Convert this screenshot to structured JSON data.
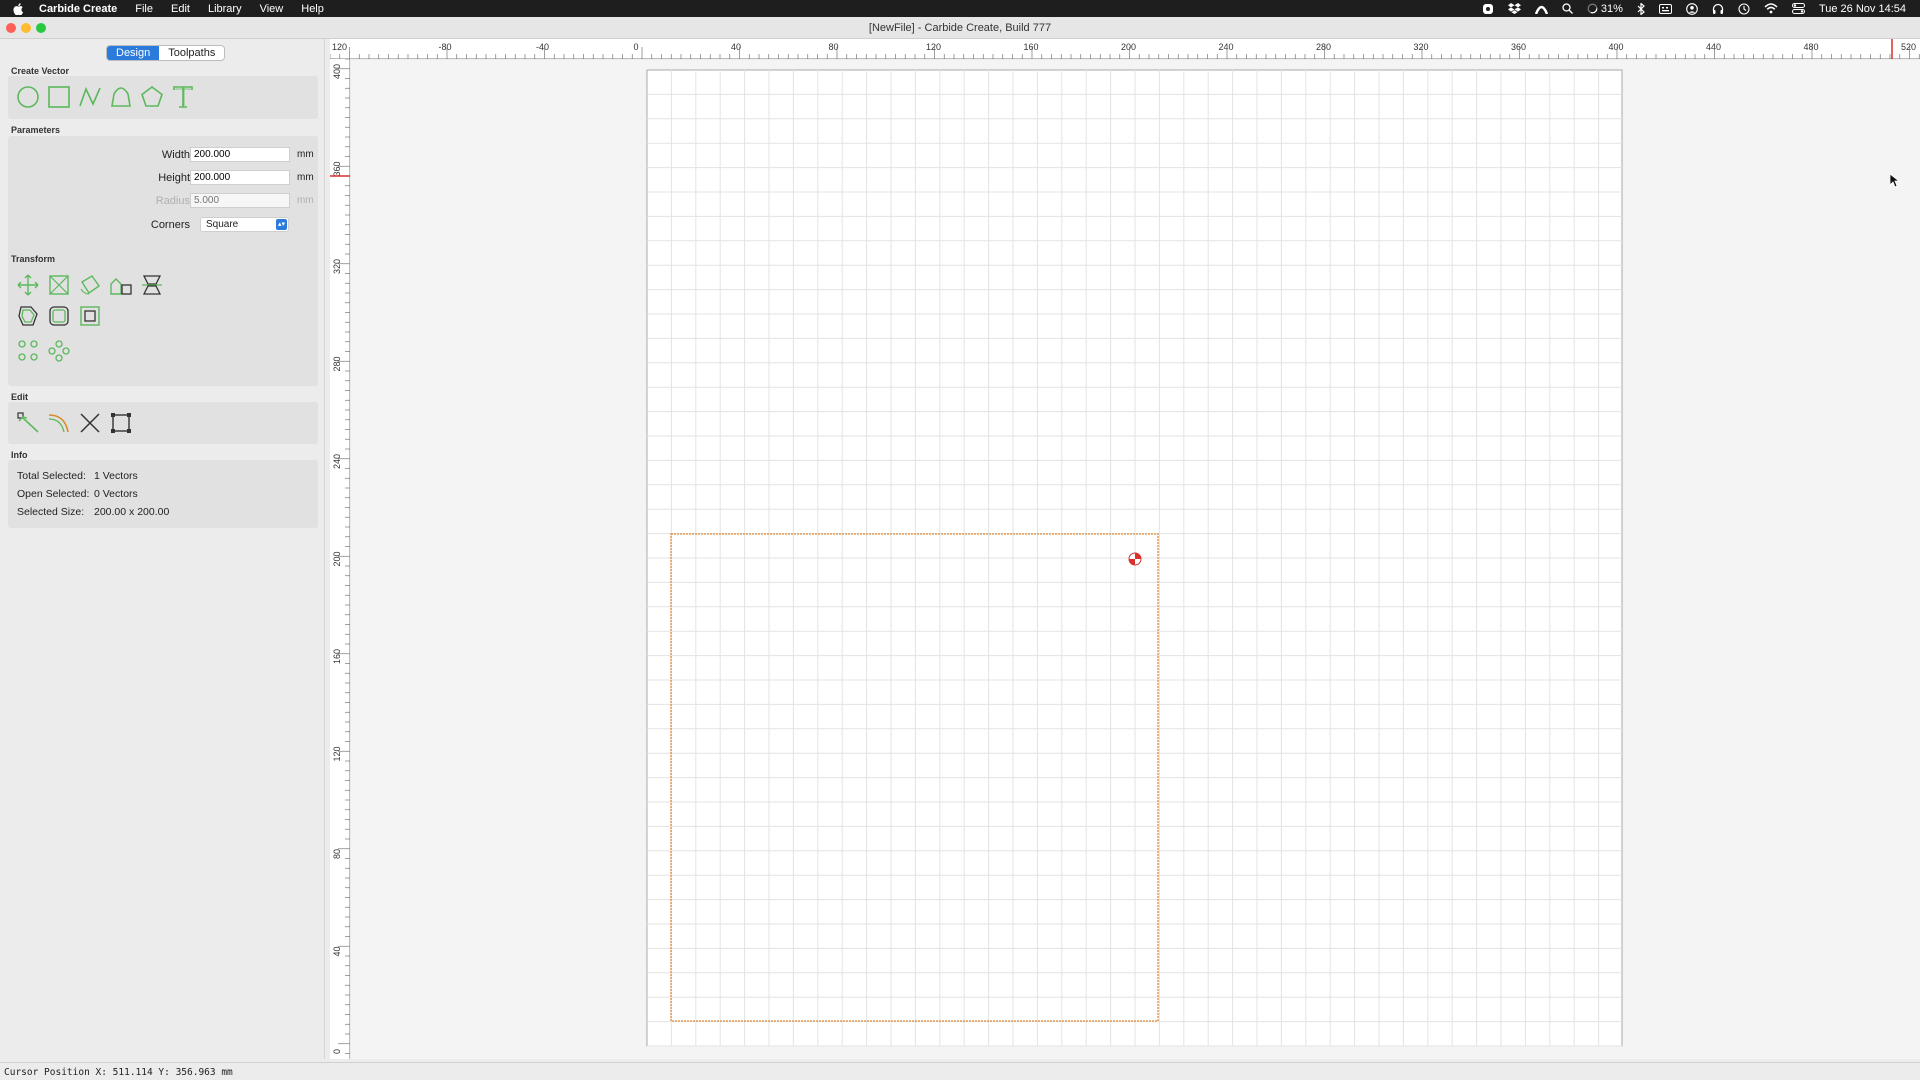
{
  "menubar": {
    "app_name": "Carbide Create",
    "items": [
      "File",
      "Edit",
      "Library",
      "View",
      "Help"
    ],
    "battery": "31%",
    "datetime": "Tue 26 Nov  14:54"
  },
  "window": {
    "title": "[NewFile] - Carbide Create, Build 777"
  },
  "tabs": [
    "Design",
    "Toolpaths"
  ],
  "sections": {
    "create_vector": "Create Vector",
    "parameters": "Parameters",
    "transform": "Transform",
    "edit": "Edit",
    "info": "Info"
  },
  "parameters": {
    "width_label": "Width",
    "width_value": "200.000",
    "height_label": "Height",
    "height_value": "200.000",
    "radius_label": "Radius",
    "radius_placeholder": "5.000",
    "unit": "mm",
    "corners_label": "Corners",
    "corners_value": "Square"
  },
  "info": {
    "total_selected_label": "Total Selected:",
    "total_selected_value": "1 Vectors",
    "open_selected_label": "Open Selected:",
    "open_selected_value": "0 Vectors",
    "selected_size_label": "Selected Size:",
    "selected_size_value": "200.00 x 200.00"
  },
  "rulers": {
    "top_labels": [
      "120",
      "-80",
      "-40",
      "0",
      "40",
      "80",
      "120",
      "160",
      "200",
      "240",
      "280",
      "320",
      "360",
      "400",
      "440",
      "480",
      "520"
    ],
    "left_labels": [
      "400",
      "360",
      "320",
      "280",
      "240",
      "200",
      "160",
      "120",
      "80",
      "40",
      "0"
    ]
  },
  "status": {
    "cursor_position": "Cursor Position X: 511.114 Y: 356.963 mm"
  },
  "colors": {
    "accent": "#2a7bdc",
    "tool_icon_green": "#5cb85c",
    "selection_orange": "#e08a3c",
    "ruler_marker_red": "#d9302c"
  },
  "icons": {
    "create_vector": [
      "circle-icon",
      "rectangle-icon",
      "polyline-icon",
      "curve-icon",
      "polygon-icon",
      "text-icon"
    ],
    "transform": [
      "move-icon",
      "scale-icon",
      "rotate-icon",
      "align-icon",
      "mirror-icon",
      "offset-icon",
      "boolean-icon",
      "inset-icon",
      "circular-pattern-icon",
      "linear-pattern-icon"
    ],
    "edit": [
      "node-edit-icon",
      "fillet-icon",
      "trim-icon",
      "bounding-box-icon"
    ]
  }
}
